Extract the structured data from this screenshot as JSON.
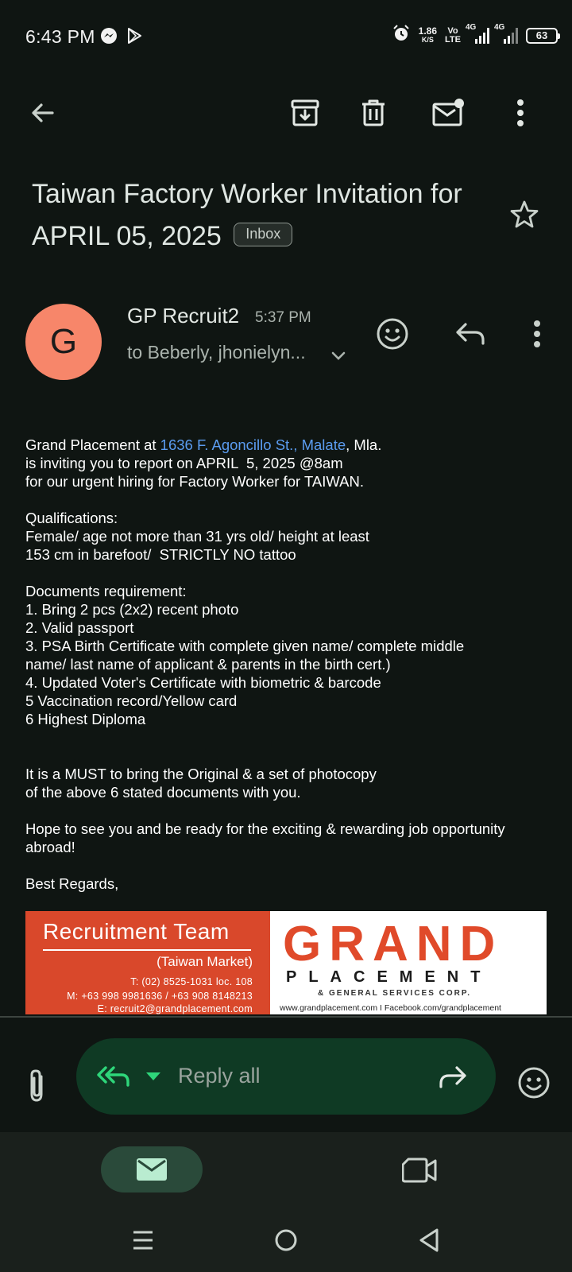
{
  "status_bar": {
    "time": "6:43 PM",
    "net_speed_value": "1.86",
    "net_speed_unit": "K/S",
    "volte_top": "Vo",
    "volte_bottom": "LTE",
    "signal1_label": "4G",
    "signal2_label": "4G",
    "battery": "63"
  },
  "toolbar": {
    "back_icon": "arrow-left-icon",
    "archive_icon": "archive-icon",
    "delete_icon": "trash-icon",
    "mark_unread_icon": "mail-unread-icon",
    "more_icon": "more-vertical-icon"
  },
  "email": {
    "subject": "Taiwan Factory Worker Invitation for APRIL 05, 2025",
    "label": "Inbox",
    "sender_initial": "G",
    "sender_name": "GP Recruit2",
    "time": "5:37 PM",
    "recipients": "to Beberly, jhonielyn...",
    "avatar_color": "#f7866a"
  },
  "body": {
    "l1_prefix": "Grand Placement at ",
    "l1_link": "1636 F. Agoncillo St., Malate",
    "l1_suffix": ", Mla.",
    "l2": "is inviting you to report on APRIL  5, 2025 @8am",
    "l3": "for our urgent hiring for Factory Worker for TAIWAN.",
    "q_title": "Qualifications:",
    "q1": "Female/ age not more than 31 yrs old/ height at least",
    "q2": "153 cm in barefoot/  STRICTLY NO tattoo",
    "d_title": "Documents requirement:",
    "d1": "1. Bring 2 pcs (2x2) recent photo",
    "d2": "2. Valid passport",
    "d3a": "3. PSA Birth Certificate with complete given name/ complete middle",
    "d3b": "name/ last name of applicant & parents in the birth cert.)",
    "d4": "4. Updated Voter's Certificate with biometric & barcode",
    "d5": "5 Vaccination record/Yellow card",
    "d6": "6 Highest Diploma",
    "m1": "It is a MUST to bring the Original & a set of photocopy",
    "m2": "of the above 6 stated documents with you.",
    "h1": "Hope to see you and be ready for the exciting & rewarding job opportunity",
    "h2": "abroad!",
    "regards": "Best Regards,"
  },
  "banner": {
    "team": "Recruitment Team",
    "market": "(Taiwan Market)",
    "tel": "T: (02) 8525-1031 loc. 108",
    "mobile": "M: +63 998 9981636 / +63 908 8148213",
    "email": "E: recruit2@grandplacement.com",
    "grand": "GRAND",
    "placement": "PLACEMENT",
    "general": "& GENERAL SERVICES CORP.",
    "web": "www.grandplacement.com  I  Facebook.com/grandplacement",
    "accent": "#d9482b"
  },
  "compose": {
    "reply_label": "Reply all",
    "accent": "#2ed67a"
  },
  "bottom_nav": {
    "mail_icon": "mail-icon",
    "meet_icon": "video-icon"
  }
}
